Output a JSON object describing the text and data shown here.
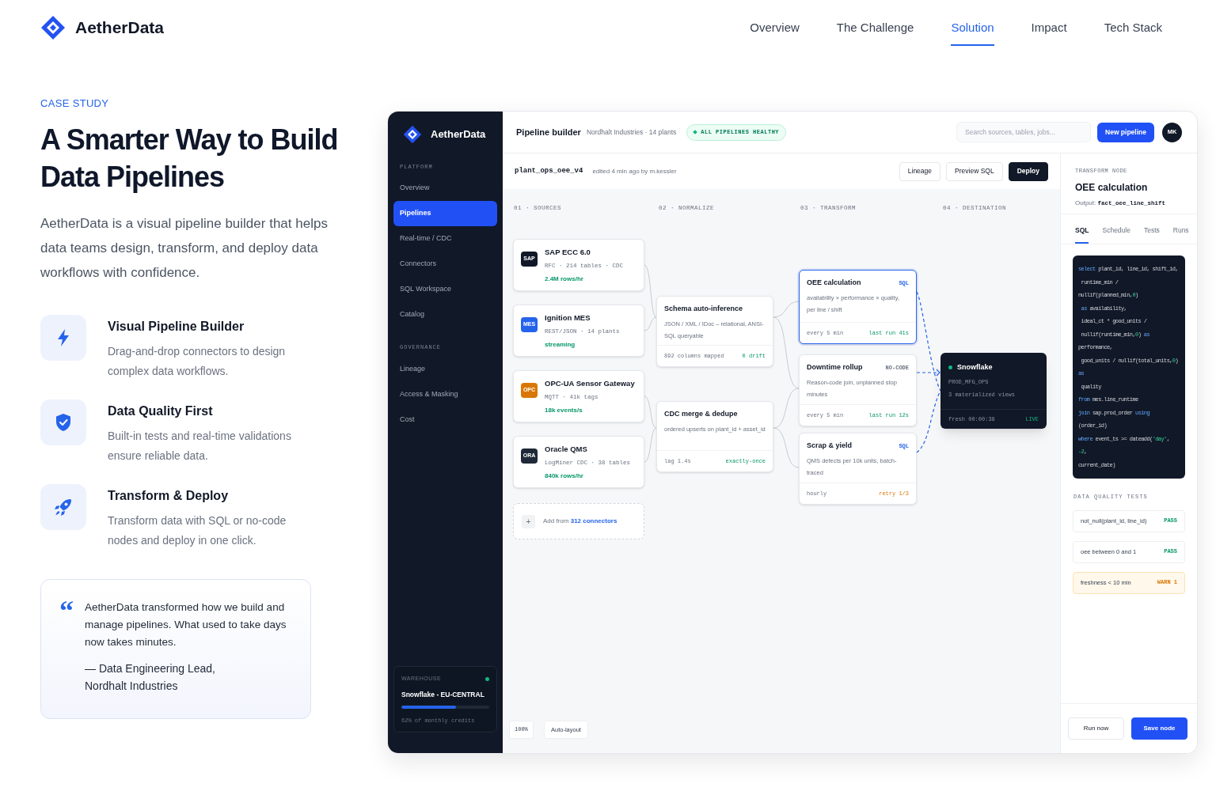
{
  "site": {
    "brand": "AetherData",
    "nav": [
      {
        "label": "Overview",
        "selected": false
      },
      {
        "label": "The Challenge",
        "selected": false
      },
      {
        "label": "Solution",
        "selected": true
      },
      {
        "label": "Impact",
        "selected": false
      },
      {
        "label": "Tech Stack",
        "selected": false
      }
    ]
  },
  "hero": {
    "eyebrow": "CASE STUDY",
    "title": "A Smarter Way to Build Data Pipelines",
    "lead": "AetherData is a visual pipeline builder that helps data teams design, transform, and deploy data workflows with confidence.",
    "features": [
      {
        "kind": "bolt",
        "title": "Visual Pipeline Builder",
        "text": "Drag-and-drop connectors to design complex data workflows."
      },
      {
        "kind": "shield",
        "title": "Data Quality First",
        "text": "Built-in tests and real-time validations ensure reliable data."
      },
      {
        "kind": "rocket",
        "title": "Transform & Deploy",
        "text": "Transform data with SQL or no-code nodes and deploy in one click."
      }
    ],
    "quote": {
      "mark": "“",
      "text": "AetherData transformed how we build and manage pipelines. What used to take days now takes minutes.",
      "attribution": "— Data Engineering Lead,",
      "organization": "Nordhalt Industries"
    }
  },
  "app": {
    "brand": "AetherData",
    "sidebar": {
      "sections": [
        {
          "heading": "PLATFORM",
          "items": [
            {
              "label": "Overview",
              "selected": false
            },
            {
              "label": "Pipelines",
              "selected": true
            },
            {
              "label": "Real-time / CDC",
              "selected": false
            },
            {
              "label": "Connectors",
              "selected": false
            },
            {
              "label": "SQL Workspace",
              "selected": false
            },
            {
              "label": "Catalog",
              "selected": false
            }
          ]
        },
        {
          "heading": "GOVERNANCE",
          "items": [
            {
              "label": "Lineage",
              "selected": false
            },
            {
              "label": "Access & Masking",
              "selected": false
            },
            {
              "label": "Cost",
              "selected": false
            }
          ]
        }
      ],
      "warehouse": {
        "label": "WAREHOUSE",
        "online": true,
        "name": "Snowflake - EU-CENTRAL",
        "level": 0.62,
        "usage": "62% of monthly credits"
      }
    },
    "topbar": {
      "title": "Pipeline builder",
      "subtitle": "Nordhalt Industries · 14 plants",
      "status": "ALL PIPELINES HEALTHY",
      "search": {
        "placeholder": "Search sources, tables, jobs..."
      },
      "primary_button": "New pipeline",
      "avatar": "MK"
    },
    "toolbar": {
      "pipeline": "plant_ops_oee_v4",
      "edited": "edited 4 min ago by m.kessler",
      "buttons": [
        {
          "label": "Lineage",
          "kind": "outline"
        },
        {
          "label": "Preview SQL",
          "kind": "outline"
        },
        {
          "label": "Deploy",
          "kind": "primary"
        }
      ]
    },
    "canvas": {
      "stages": [
        "01 · SOURCES",
        "02 · NORMALIZE",
        "03 · TRANSFORM",
        "04 · DESTINATION"
      ],
      "sources": [
        {
          "badge": "SAP",
          "color": "#111827",
          "name": "SAP ECC 6.0",
          "detail": "RFC · 214 tables · CDC",
          "metric": "2.4M rows/hr"
        },
        {
          "badge": "MES",
          "color": "#2563eb",
          "name": "Ignition MES",
          "detail": "REST/JSON · 14 plants",
          "metric": "streaming"
        },
        {
          "badge": "OPC",
          "color": "#d97706",
          "name": "OPC-UA Sensor Gateway",
          "detail": "MQTT · 41k tags",
          "metric": "18k events/s"
        },
        {
          "badge": "ORA",
          "color": "#1f2937",
          "name": "Oracle QMS",
          "detail": "LogMiner CDC · 38 tables",
          "metric": "840k rows/hr"
        }
      ],
      "add": {
        "icon": "+",
        "text": "Add from ",
        "link": "312 connectors"
      },
      "steps": [
        {
          "title": "Schema auto-inference",
          "description": "JSON / XML / IDoc – relational, ANSI-SQL queryable",
          "meta": "892 columns mapped",
          "result": {
            "text": "0 drift",
            "kind": "ok"
          },
          "selected": false
        },
        {
          "title": "CDC merge & dedupe",
          "description": "ordered upserts on plant_id + asset_id",
          "meta": "lag 1.4s",
          "result": {
            "text": "exactly-once",
            "kind": "ok"
          },
          "selected": false
        },
        {
          "title": "OEE calculation",
          "tag": {
            "text": "SQL",
            "kind": "sql"
          },
          "description": "availability × performance × quality, per line / shift",
          "meta": "every 5 min",
          "result": {
            "text": "last run 41s",
            "kind": "ok"
          },
          "selected": true
        },
        {
          "title": "Downtime rollup",
          "tag": {
            "text": "NO-CODE",
            "kind": "nocode"
          },
          "description": "Reason-code join, unplanned stop minutes",
          "meta": "every 5 min",
          "result": {
            "text": "last run 12s",
            "kind": "ok"
          },
          "selected": false
        },
        {
          "title": "Scrap & yield",
          "tag": {
            "text": "SQL",
            "kind": "sql"
          },
          "description": "QMS defects per 10k units, batch-traced",
          "meta": "hourly",
          "result": {
            "text": "retry 1/3",
            "kind": "warn"
          },
          "selected": false
        }
      ],
      "destination": {
        "name": "Snowflake",
        "online": true,
        "schema": "PROD_MFG_OPS",
        "detail": "3 materialized views",
        "freshness": "fresh 00:00:38",
        "state": "LIVE"
      },
      "zoom": "100%",
      "layout_button": "Auto-layout"
    },
    "inspector": {
      "eyebrow": "TRANSFORM NODE",
      "title": "OEE calculation",
      "output_label": "Output: ",
      "output": "fact_oee_line_shift",
      "tabs": [
        {
          "label": "SQL",
          "selected": true
        },
        {
          "label": "Schedule",
          "selected": false
        },
        {
          "label": "Tests",
          "selected": false
        },
        {
          "label": "Runs",
          "selected": false
        }
      ],
      "code": [
        [
          {
            "kind": "keyword",
            "text": "select"
          },
          {
            "kind": "plain",
            "text": " plant_id, line_id, shift_id,"
          }
        ],
        [
          {
            "kind": "plain",
            "text": " runtime_min / nullif(planned_min,"
          },
          {
            "kind": "number",
            "text": "0"
          },
          {
            "kind": "plain",
            "text": ")"
          }
        ],
        [
          {
            "kind": "keyword",
            "text": " as"
          },
          {
            "kind": "plain",
            "text": " availability,"
          }
        ],
        [
          {
            "kind": "plain",
            "text": " ideal_ct * good_units /"
          }
        ],
        [
          {
            "kind": "plain",
            "text": " nullif(runtime_min,"
          },
          {
            "kind": "number",
            "text": "0"
          },
          {
            "kind": "plain",
            "text": ") "
          },
          {
            "kind": "keyword",
            "text": "as"
          },
          {
            "kind": "plain",
            "text": " performance,"
          }
        ],
        [
          {
            "kind": "plain",
            "text": " good_units / nullif(total_units,"
          },
          {
            "kind": "number",
            "text": "0"
          },
          {
            "kind": "plain",
            "text": ") "
          },
          {
            "kind": "keyword",
            "text": "as"
          }
        ],
        [
          {
            "kind": "plain",
            "text": " quality"
          }
        ],
        [
          {
            "kind": "keyword",
            "text": "from"
          },
          {
            "kind": "plain",
            "text": " mes.line_runtime"
          }
        ],
        [
          {
            "kind": "keyword",
            "text": "join"
          },
          {
            "kind": "plain",
            "text": " sap.prod_order "
          },
          {
            "kind": "keyword",
            "text": "using"
          },
          {
            "kind": "plain",
            "text": " (order_id)"
          }
        ],
        [
          {
            "kind": "keyword",
            "text": "where"
          },
          {
            "kind": "plain",
            "text": " event_ts >= dateadd("
          },
          {
            "kind": "string",
            "text": "'day'"
          },
          {
            "kind": "plain",
            "text": ", "
          },
          {
            "kind": "number",
            "text": "-2"
          },
          {
            "kind": "plain",
            "text": ","
          }
        ],
        [
          {
            "kind": "plain",
            "text": "current_date)"
          }
        ]
      ],
      "tests_heading": "DATA QUALITY TESTS",
      "tests": [
        {
          "name": "not_null(plant_id, line_id)",
          "result": "PASS",
          "kind": "pass"
        },
        {
          "name": "oee between 0 and 1",
          "result": "PASS",
          "kind": "pass"
        },
        {
          "name": "freshness < 10 min",
          "result": "WARN 1",
          "kind": "warn"
        }
      ],
      "buttons": [
        {
          "label": "Run now",
          "kind": "outline"
        },
        {
          "label": "Save node",
          "kind": "primary"
        }
      ]
    }
  }
}
